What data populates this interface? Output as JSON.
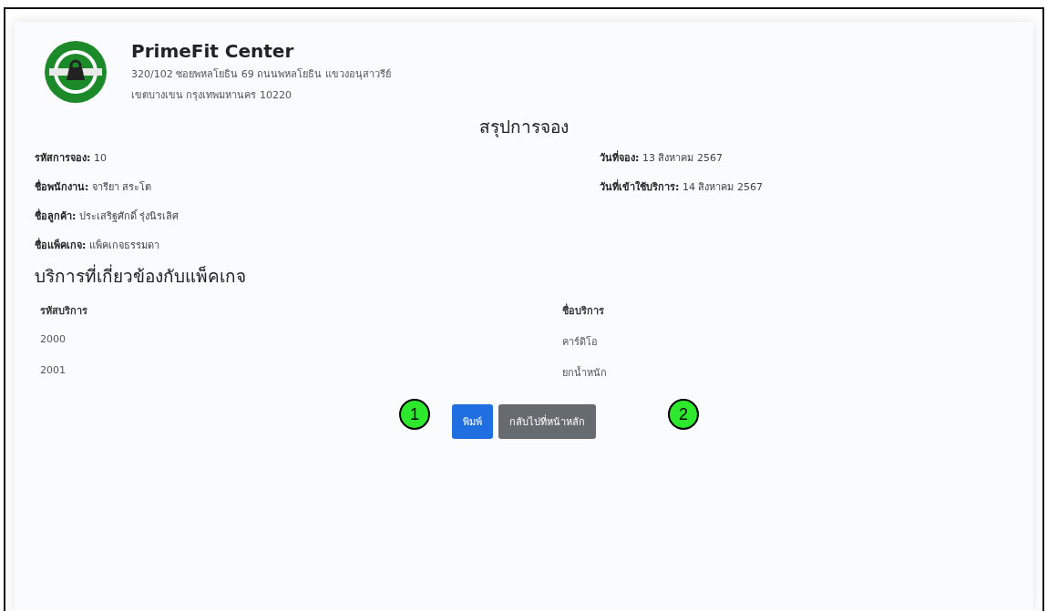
{
  "company": {
    "name": "PrimeFit Center",
    "address": [
      "320/102 ซอยพหลโยธิน 69 ถนนพหลโยธิน แขวงอนุสาวรีย์",
      "เขตบางเขน กรุงเทพมหานคร 10220"
    ]
  },
  "title": "สรุปการจอง",
  "details_left": [
    {
      "label": "รหัสการจอง:",
      "value": "10"
    },
    {
      "label": "ชื่อพนักงาน:",
      "value": "จารียา สระโต"
    },
    {
      "label": "ชื่อลูกค้า:",
      "value": "ประเสริฐศักดิ์ รุ่งนิรเลิศ"
    },
    {
      "label": "ชื่อแพ็คเกจ:",
      "value": "แพ็คเกจธรรมดา"
    }
  ],
  "details_right": [
    {
      "label": "วันที่จอง:",
      "value": "13 สิงหาคม 2567"
    },
    {
      "label": "วันที่เข้าใช้บริการ:",
      "value": "14 สิงหาคม 2567"
    }
  ],
  "services": {
    "heading": "บริการที่เกี่ยวข้องกับแพ็คเกจ",
    "columns": [
      "รหัสบริการ",
      "ชื่อบริการ"
    ],
    "rows": [
      [
        "2000",
        "คาร์ดิโอ"
      ],
      [
        "2001",
        "ยกน้ำหนัก"
      ]
    ]
  },
  "buttons": [
    {
      "label": "พิมพ์",
      "kind": "primary"
    },
    {
      "label": "กลับไปที่หน้าหลัก",
      "kind": "secondary"
    }
  ],
  "callouts": [
    "1",
    "2"
  ]
}
